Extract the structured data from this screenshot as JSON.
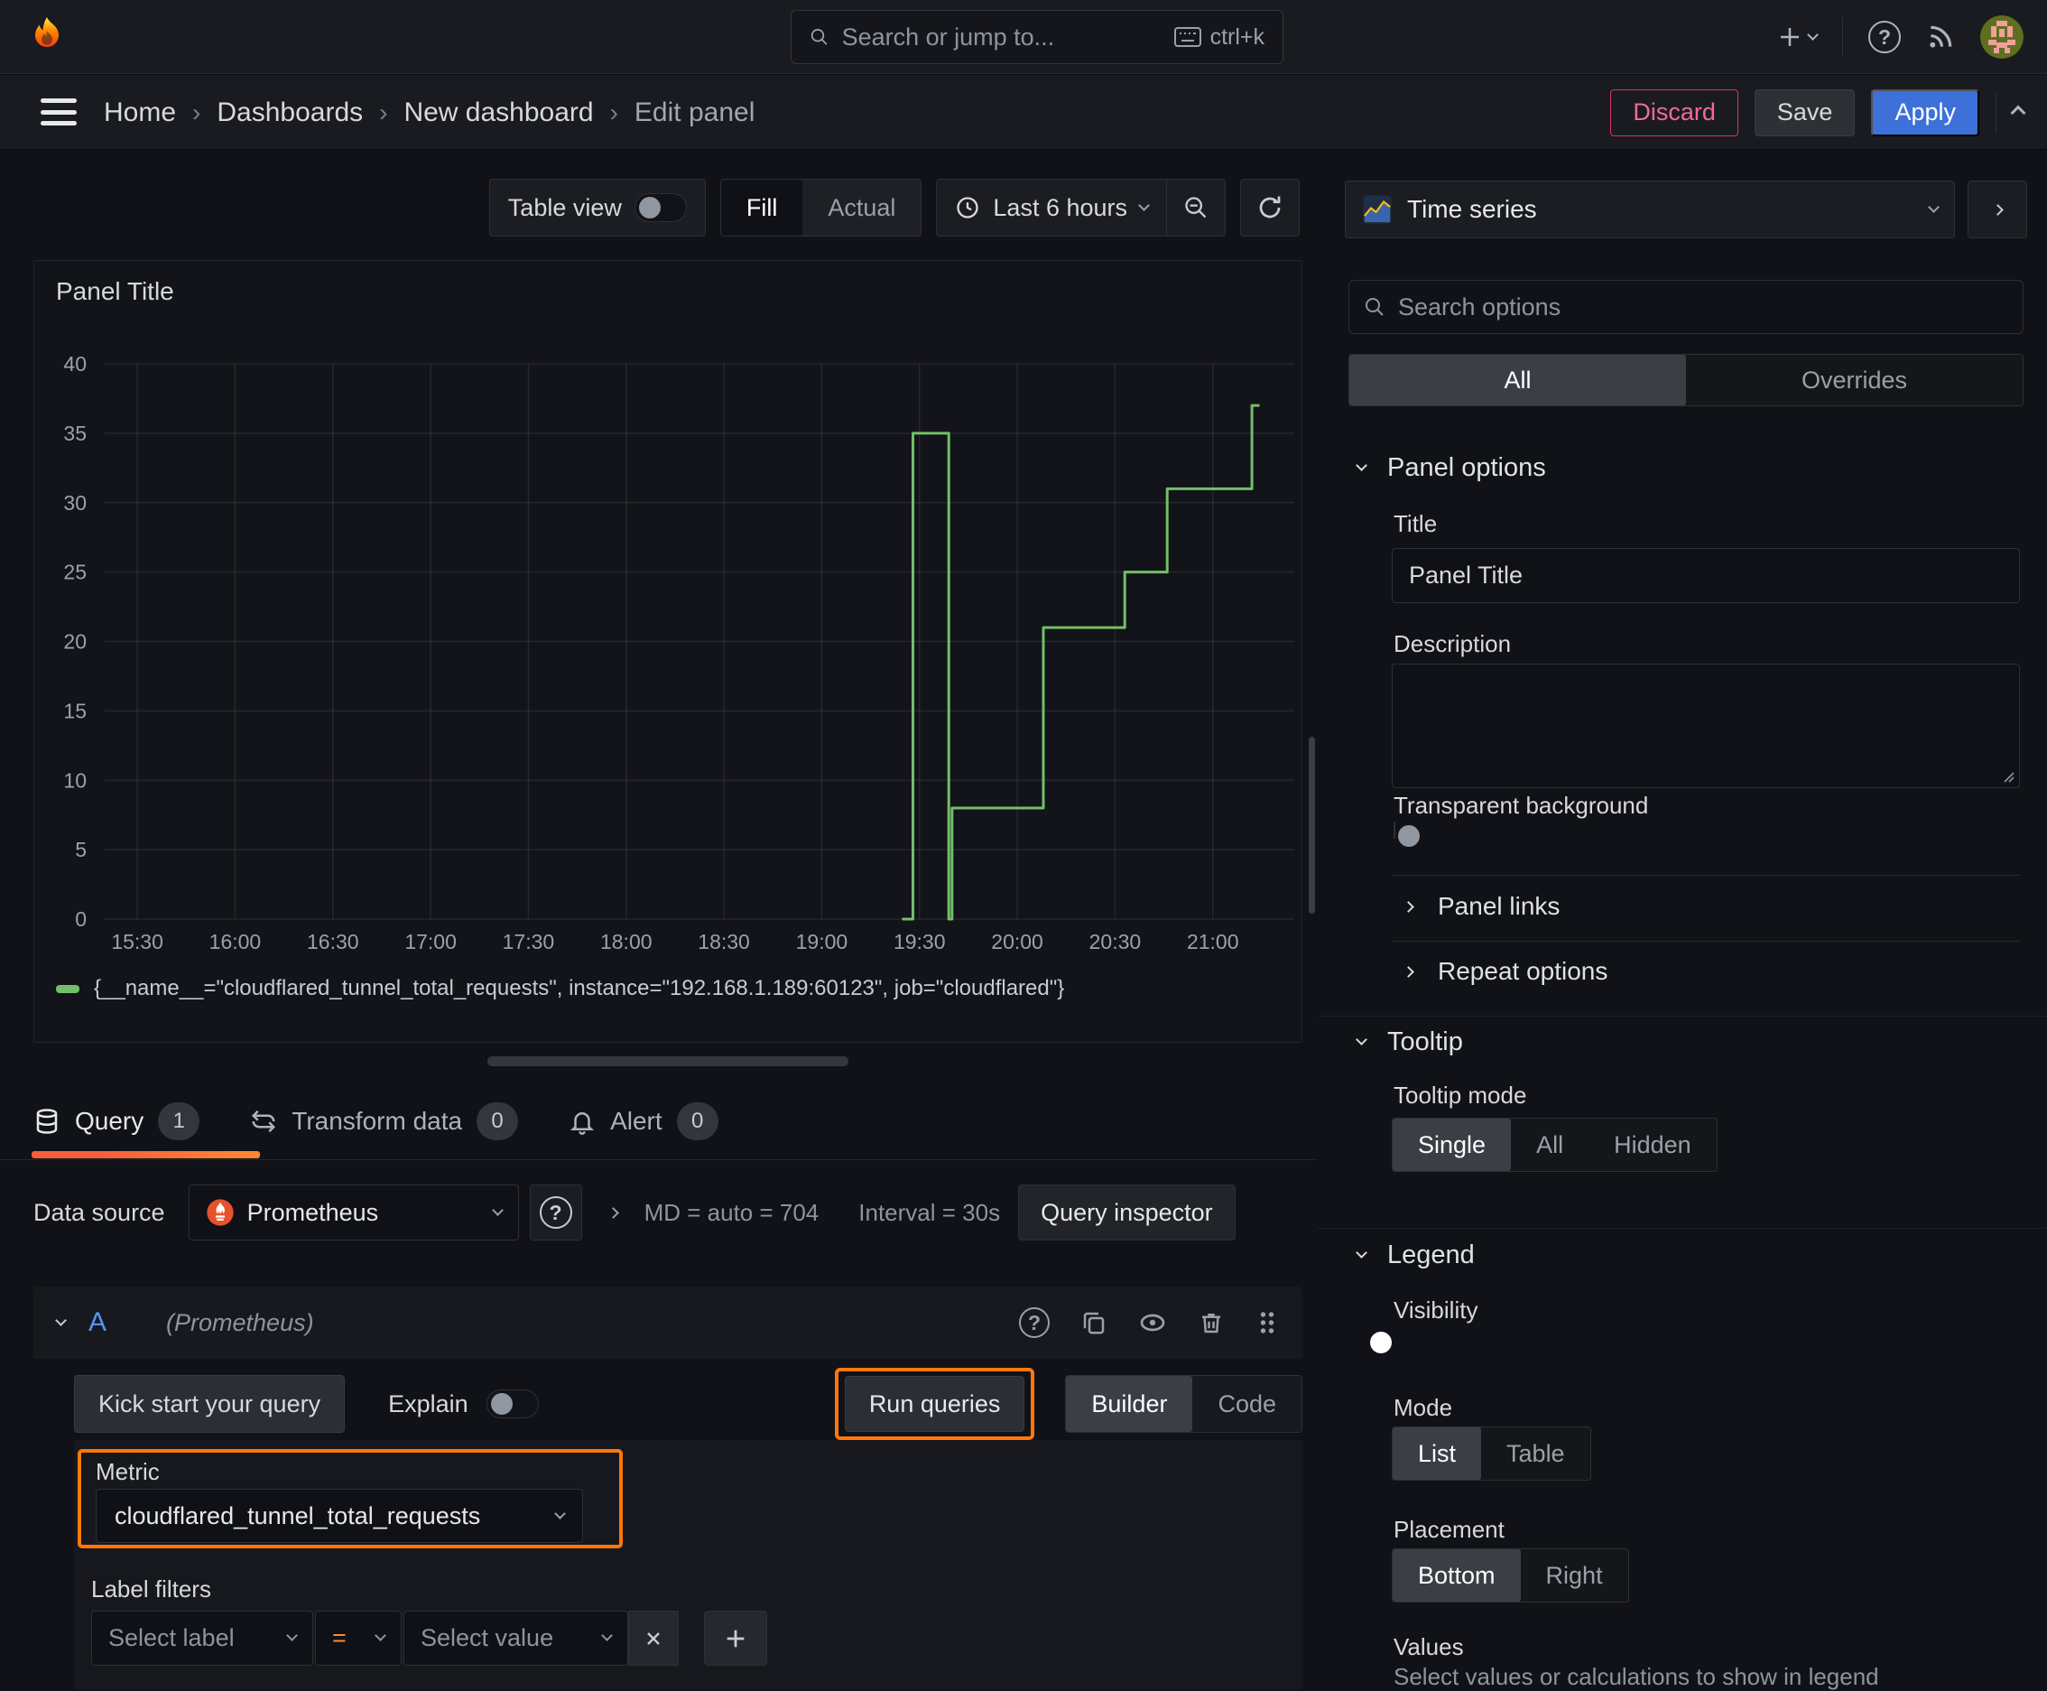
{
  "colors": {
    "accent_blue": "#3d71d9",
    "orange_highlight": "#ff780a",
    "series_green": "#73bf69",
    "discard_pink": "#e02f6e",
    "tab_underline_gradient": [
      "#f55f3e",
      "#ff8833"
    ]
  },
  "icons": [
    "grafana-logo",
    "search-icon",
    "keyboard-icon",
    "plus-icon",
    "chevron-down-icon",
    "help-icon",
    "news-icon",
    "avatar",
    "hamburger-icon",
    "clock-icon",
    "zoom-out-icon",
    "refresh-icon",
    "timeseries-viz-icon",
    "database-icon",
    "transform-icon",
    "bell-icon",
    "prometheus-icon",
    "copy-icon",
    "eye-icon",
    "trash-icon",
    "grip-icon",
    "close-icon",
    "add-icon"
  ],
  "topnav": {
    "search_placeholder": "Search or jump to...",
    "search_shortcut": "ctrl+k"
  },
  "breadcrumb": {
    "separator": "›",
    "items": [
      "Home",
      "Dashboards",
      "New dashboard",
      "Edit panel"
    ]
  },
  "actions": {
    "discard": "Discard",
    "save": "Save",
    "apply": "Apply"
  },
  "toolbar": {
    "table_view_label": "Table view",
    "table_view_enabled": false,
    "fit_mode": {
      "options": [
        "Fill",
        "Actual"
      ],
      "selected": "Fill"
    },
    "time_range_label": "Last 6 hours"
  },
  "panel": {
    "title": "Panel Title"
  },
  "chart_data": {
    "type": "line",
    "line_style": "step-after",
    "title": "Panel Title",
    "xlabel": "",
    "ylabel": "",
    "grid": true,
    "legend_position": "bottom",
    "ylim": [
      0,
      40
    ],
    "y_ticks": [
      0,
      5,
      10,
      15,
      20,
      25,
      30,
      35,
      40
    ],
    "x_ticks": [
      "15:30",
      "16:00",
      "16:30",
      "17:00",
      "17:30",
      "18:00",
      "18:30",
      "19:00",
      "19:30",
      "20:00",
      "20:30",
      "21:00"
    ],
    "x_range": [
      "15:20",
      "21:25"
    ],
    "series": [
      {
        "name": "{__name__=\"cloudflared_tunnel_total_requests\", instance=\"192.168.1.189:60123\", job=\"cloudflared\"}",
        "color": "#73bf69",
        "points": [
          [
            "19:25",
            0
          ],
          [
            "19:28",
            35
          ],
          [
            "19:39",
            0
          ],
          [
            "19:40",
            8
          ],
          [
            "20:08",
            21
          ],
          [
            "20:33",
            25
          ],
          [
            "20:46",
            31
          ],
          [
            "21:12",
            37
          ],
          [
            "21:14",
            37
          ]
        ]
      }
    ]
  },
  "editor_tabs": {
    "items": [
      {
        "label": "Query",
        "count": "1",
        "icon": "database",
        "active": true
      },
      {
        "label": "Transform data",
        "count": "0",
        "icon": "transform",
        "active": false
      },
      {
        "label": "Alert",
        "count": "0",
        "icon": "bell",
        "active": false
      }
    ]
  },
  "datasource_row": {
    "label": "Data source",
    "name": "Prometheus",
    "stats": "MD = auto = 704",
    "interval": "Interval = 30s",
    "inspector_label": "Query inspector"
  },
  "query_row": {
    "ref": "A",
    "ds_hint": "(Prometheus)"
  },
  "kickstart": {
    "kick_label": "Kick start your query",
    "explain_label": "Explain",
    "explain_enabled": false,
    "run_label": "Run queries",
    "editor_mode": {
      "options": [
        "Builder",
        "Code"
      ],
      "selected": "Builder"
    }
  },
  "metric_section": {
    "label": "Metric",
    "value": "cloudflared_tunnel_total_requests"
  },
  "label_filters": {
    "label": "Label filters",
    "select_label_placeholder": "Select label",
    "operator": "=",
    "select_value_placeholder": "Select value"
  },
  "sidebar": {
    "viz_picker_label": "Time series",
    "options_search_placeholder": "Search options",
    "options_tabs": {
      "options": [
        "All",
        "Overrides"
      ],
      "selected": "All"
    },
    "panel_options": {
      "heading": "Panel options",
      "title_label": "Title",
      "title_value": "Panel Title",
      "description_label": "Description",
      "transparent_label": "Transparent background",
      "transparent_enabled": false,
      "panel_links_label": "Panel links",
      "repeat_options_label": "Repeat options"
    },
    "tooltip": {
      "heading": "Tooltip",
      "mode_label": "Tooltip mode",
      "mode": {
        "options": [
          "Single",
          "All",
          "Hidden"
        ],
        "selected": "Single"
      }
    },
    "legend": {
      "heading": "Legend",
      "visibility_label": "Visibility",
      "visibility_enabled": true,
      "mode_label": "Mode",
      "mode": {
        "options": [
          "List",
          "Table"
        ],
        "selected": "List"
      },
      "placement_label": "Placement",
      "placement": {
        "options": [
          "Bottom",
          "Right"
        ],
        "selected": "Bottom"
      },
      "values_label": "Values",
      "values_hint": "Select values or calculations to show in legend"
    }
  }
}
